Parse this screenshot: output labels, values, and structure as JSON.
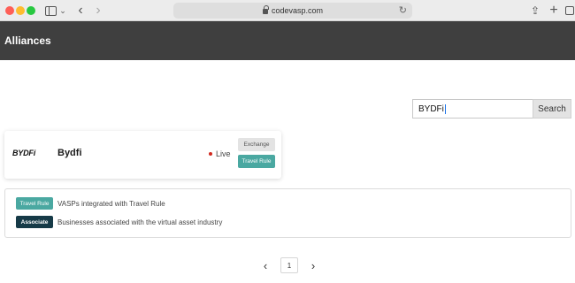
{
  "browser": {
    "url": "codevasp.com",
    "icons": [
      "sidebar-icon",
      "chevron-down-icon",
      "back-arrow-icon",
      "forward-arrow-icon",
      "lock-icon",
      "reload-icon",
      "share-icon",
      "plus-icon",
      "tabs-icon"
    ]
  },
  "header": {
    "title": "Alliances"
  },
  "search": {
    "value": "BYDFi",
    "button_label": "Search"
  },
  "results": [
    {
      "logo_text": "BYDFi",
      "name": "Bydfi",
      "status": "Live",
      "tags": [
        "Exchange",
        "Travel Rule"
      ]
    }
  ],
  "legend": [
    {
      "badge": "Travel Rule",
      "description": "VASPs integrated with Travel Rule"
    },
    {
      "badge": "Associate",
      "description": "Businesses associated with the virtual asset industry"
    }
  ],
  "pagination": {
    "current_page": "1",
    "prev_glyph": "‹",
    "next_glyph": "›"
  },
  "colors": {
    "header_bg": "#3f3f3f",
    "travel_rule": "#4aa8a1",
    "associate": "#163a47",
    "live_dot": "#d1291f"
  }
}
